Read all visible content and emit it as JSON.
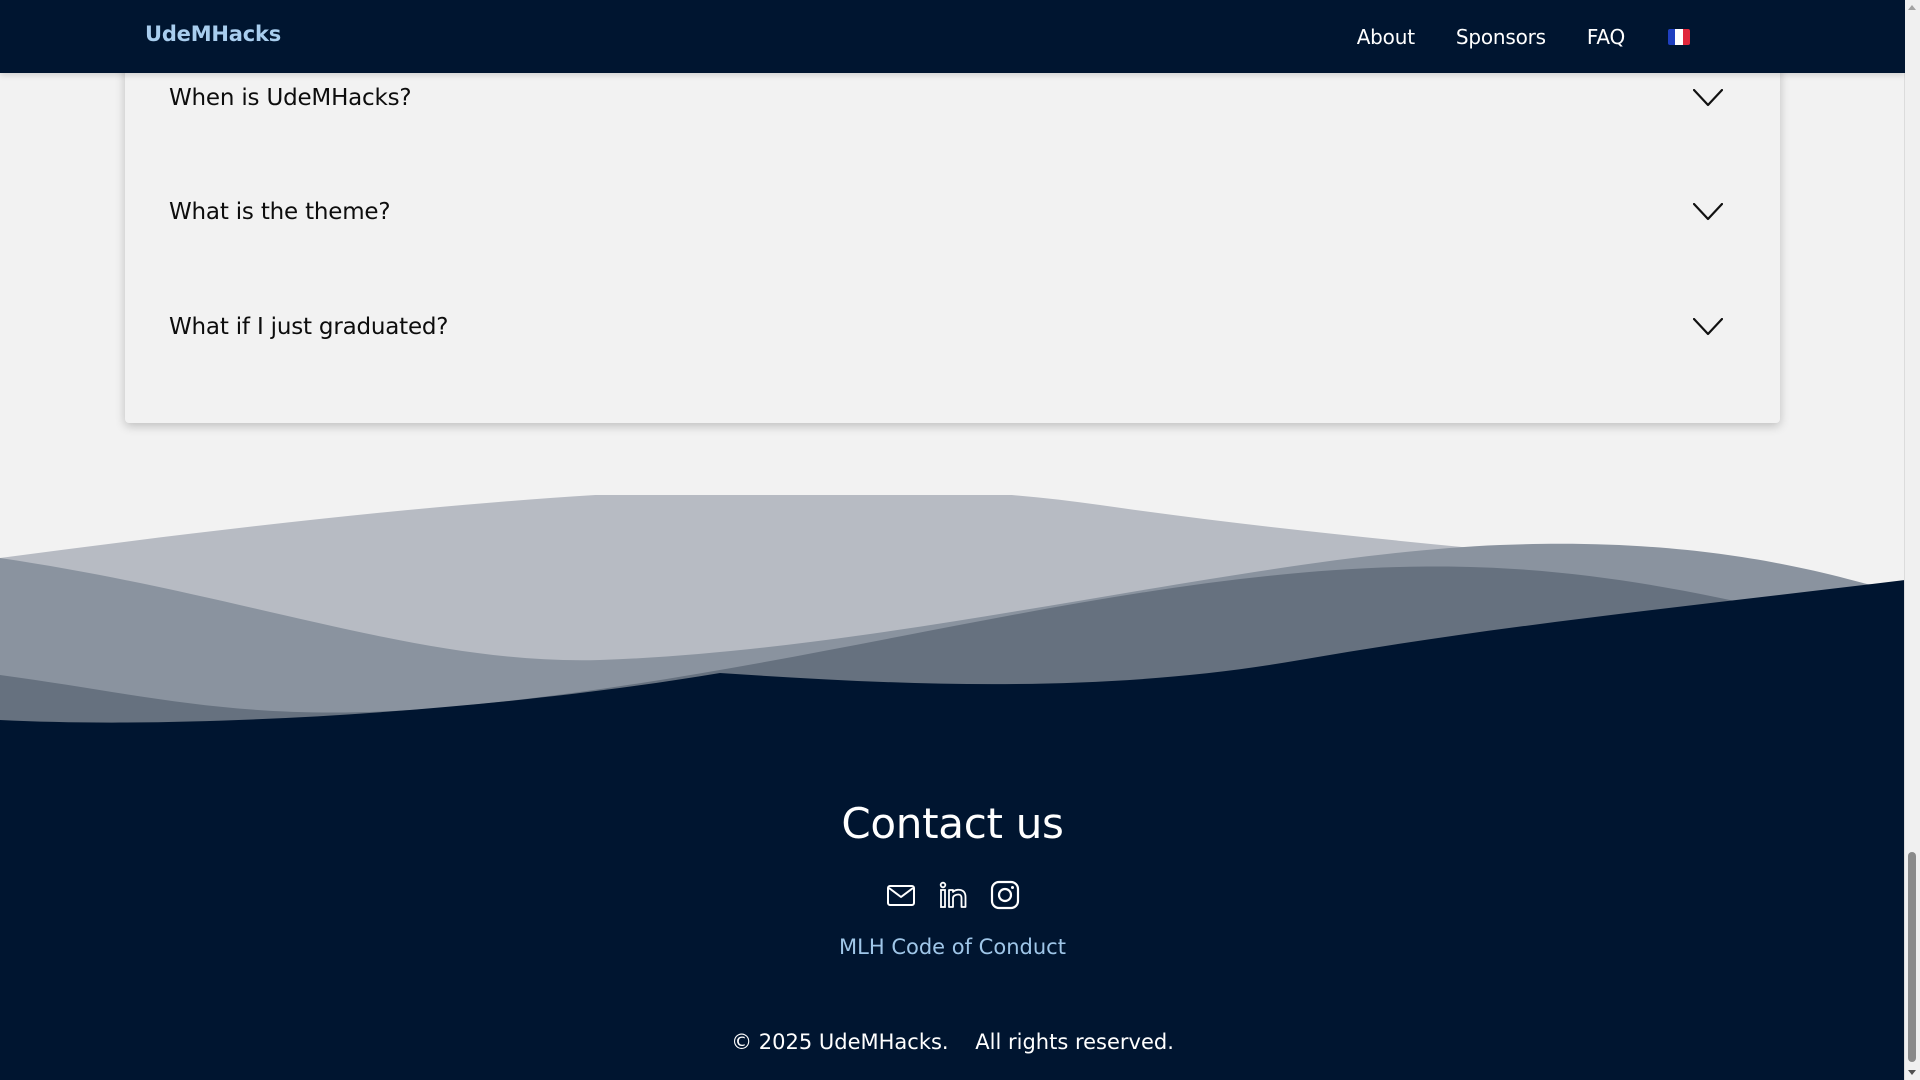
{
  "navbar": {
    "brand": "UdeMHacks",
    "links": [
      "About",
      "Sponsors",
      "FAQ"
    ],
    "language_icon": "flag-fr-icon"
  },
  "faq": {
    "questions": [
      "When is UdeMHacks?",
      "What is the theme?",
      "What if I just graduated?"
    ]
  },
  "footer": {
    "title": "Contact us",
    "icons": [
      "mail-icon",
      "linkedin-icon",
      "instagram-icon"
    ],
    "code_of_conduct": "MLH Code of Conduct",
    "copyright": "© 2025 UdeMHacks.    All rights reserved."
  },
  "colors": {
    "navy": "#001530",
    "brand_blue": "#a8cdee",
    "link_blue": "#9fc6e8",
    "background": "#f2f2f2"
  }
}
